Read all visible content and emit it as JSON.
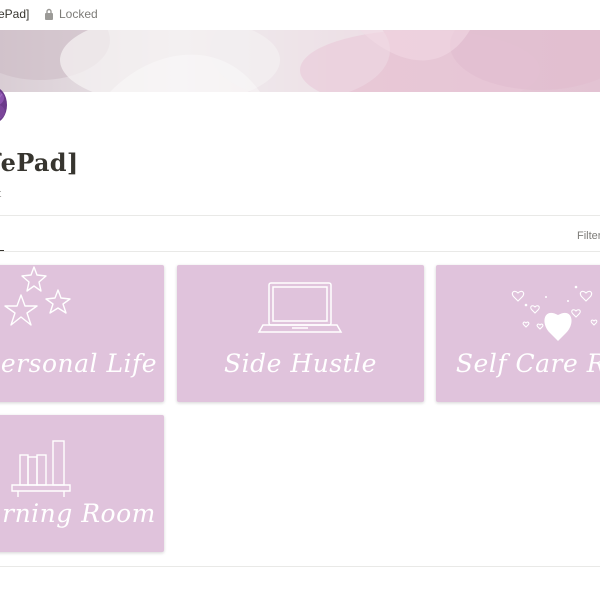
{
  "topbar": {
    "breadcrumb": "ePad]",
    "lock_status": "Locked",
    "lock_icon": "lock-icon"
  },
  "page": {
    "title": "fePad]",
    "subtitle": "nt",
    "cover_image": "pink-flower-cover",
    "page_icon": "purple-flower-icon"
  },
  "view": {
    "filter_label": "Filter"
  },
  "colors": {
    "card_background": "#e0c3dc",
    "card_text": "#ffffff",
    "divider": "#e9e9e7"
  },
  "gallery": {
    "cards": [
      {
        "label": "ersonal Life",
        "icon": "stars-icon"
      },
      {
        "label": "Side Hustle",
        "icon": "laptop-icon"
      },
      {
        "label": "Self Care R",
        "icon": "hearts-icon"
      },
      {
        "label": "rning Room",
        "icon": "bookshelf-icon"
      }
    ]
  }
}
